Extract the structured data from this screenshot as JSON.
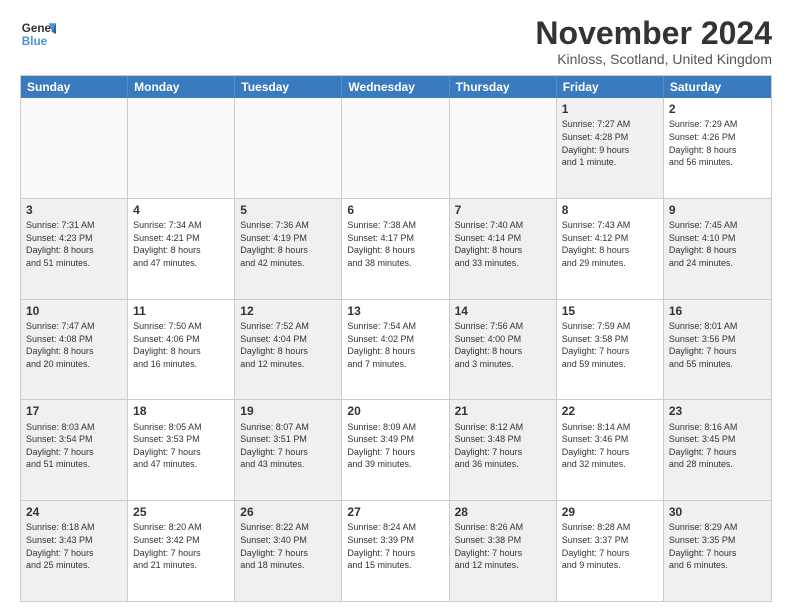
{
  "logo": {
    "line1": "General",
    "line2": "Blue"
  },
  "title": "November 2024",
  "subtitle": "Kinloss, Scotland, United Kingdom",
  "header_days": [
    "Sunday",
    "Monday",
    "Tuesday",
    "Wednesday",
    "Thursday",
    "Friday",
    "Saturday"
  ],
  "weeks": [
    [
      {
        "day": "",
        "text": "",
        "empty": true
      },
      {
        "day": "",
        "text": "",
        "empty": true
      },
      {
        "day": "",
        "text": "",
        "empty": true
      },
      {
        "day": "",
        "text": "",
        "empty": true
      },
      {
        "day": "",
        "text": "",
        "empty": true
      },
      {
        "day": "1",
        "text": "Sunrise: 7:27 AM\nSunset: 4:28 PM\nDaylight: 9 hours\nand 1 minute.",
        "shaded": true
      },
      {
        "day": "2",
        "text": "Sunrise: 7:29 AM\nSunset: 4:26 PM\nDaylight: 8 hours\nand 56 minutes.",
        "shaded": false
      }
    ],
    [
      {
        "day": "3",
        "text": "Sunrise: 7:31 AM\nSunset: 4:23 PM\nDaylight: 8 hours\nand 51 minutes.",
        "shaded": true
      },
      {
        "day": "4",
        "text": "Sunrise: 7:34 AM\nSunset: 4:21 PM\nDaylight: 8 hours\nand 47 minutes.",
        "shaded": false
      },
      {
        "day": "5",
        "text": "Sunrise: 7:36 AM\nSunset: 4:19 PM\nDaylight: 8 hours\nand 42 minutes.",
        "shaded": true
      },
      {
        "day": "6",
        "text": "Sunrise: 7:38 AM\nSunset: 4:17 PM\nDaylight: 8 hours\nand 38 minutes.",
        "shaded": false
      },
      {
        "day": "7",
        "text": "Sunrise: 7:40 AM\nSunset: 4:14 PM\nDaylight: 8 hours\nand 33 minutes.",
        "shaded": true
      },
      {
        "day": "8",
        "text": "Sunrise: 7:43 AM\nSunset: 4:12 PM\nDaylight: 8 hours\nand 29 minutes.",
        "shaded": false
      },
      {
        "day": "9",
        "text": "Sunrise: 7:45 AM\nSunset: 4:10 PM\nDaylight: 8 hours\nand 24 minutes.",
        "shaded": true
      }
    ],
    [
      {
        "day": "10",
        "text": "Sunrise: 7:47 AM\nSunset: 4:08 PM\nDaylight: 8 hours\nand 20 minutes.",
        "shaded": true
      },
      {
        "day": "11",
        "text": "Sunrise: 7:50 AM\nSunset: 4:06 PM\nDaylight: 8 hours\nand 16 minutes.",
        "shaded": false
      },
      {
        "day": "12",
        "text": "Sunrise: 7:52 AM\nSunset: 4:04 PM\nDaylight: 8 hours\nand 12 minutes.",
        "shaded": true
      },
      {
        "day": "13",
        "text": "Sunrise: 7:54 AM\nSunset: 4:02 PM\nDaylight: 8 hours\nand 7 minutes.",
        "shaded": false
      },
      {
        "day": "14",
        "text": "Sunrise: 7:56 AM\nSunset: 4:00 PM\nDaylight: 8 hours\nand 3 minutes.",
        "shaded": true
      },
      {
        "day": "15",
        "text": "Sunrise: 7:59 AM\nSunset: 3:58 PM\nDaylight: 7 hours\nand 59 minutes.",
        "shaded": false
      },
      {
        "day": "16",
        "text": "Sunrise: 8:01 AM\nSunset: 3:56 PM\nDaylight: 7 hours\nand 55 minutes.",
        "shaded": true
      }
    ],
    [
      {
        "day": "17",
        "text": "Sunrise: 8:03 AM\nSunset: 3:54 PM\nDaylight: 7 hours\nand 51 minutes.",
        "shaded": true
      },
      {
        "day": "18",
        "text": "Sunrise: 8:05 AM\nSunset: 3:53 PM\nDaylight: 7 hours\nand 47 minutes.",
        "shaded": false
      },
      {
        "day": "19",
        "text": "Sunrise: 8:07 AM\nSunset: 3:51 PM\nDaylight: 7 hours\nand 43 minutes.",
        "shaded": true
      },
      {
        "day": "20",
        "text": "Sunrise: 8:09 AM\nSunset: 3:49 PM\nDaylight: 7 hours\nand 39 minutes.",
        "shaded": false
      },
      {
        "day": "21",
        "text": "Sunrise: 8:12 AM\nSunset: 3:48 PM\nDaylight: 7 hours\nand 36 minutes.",
        "shaded": true
      },
      {
        "day": "22",
        "text": "Sunrise: 8:14 AM\nSunset: 3:46 PM\nDaylight: 7 hours\nand 32 minutes.",
        "shaded": false
      },
      {
        "day": "23",
        "text": "Sunrise: 8:16 AM\nSunset: 3:45 PM\nDaylight: 7 hours\nand 28 minutes.",
        "shaded": true
      }
    ],
    [
      {
        "day": "24",
        "text": "Sunrise: 8:18 AM\nSunset: 3:43 PM\nDaylight: 7 hours\nand 25 minutes.",
        "shaded": true
      },
      {
        "day": "25",
        "text": "Sunrise: 8:20 AM\nSunset: 3:42 PM\nDaylight: 7 hours\nand 21 minutes.",
        "shaded": false
      },
      {
        "day": "26",
        "text": "Sunrise: 8:22 AM\nSunset: 3:40 PM\nDaylight: 7 hours\nand 18 minutes.",
        "shaded": true
      },
      {
        "day": "27",
        "text": "Sunrise: 8:24 AM\nSunset: 3:39 PM\nDaylight: 7 hours\nand 15 minutes.",
        "shaded": false
      },
      {
        "day": "28",
        "text": "Sunrise: 8:26 AM\nSunset: 3:38 PM\nDaylight: 7 hours\nand 12 minutes.",
        "shaded": true
      },
      {
        "day": "29",
        "text": "Sunrise: 8:28 AM\nSunset: 3:37 PM\nDaylight: 7 hours\nand 9 minutes.",
        "shaded": false
      },
      {
        "day": "30",
        "text": "Sunrise: 8:29 AM\nSunset: 3:35 PM\nDaylight: 7 hours\nand 6 minutes.",
        "shaded": true
      }
    ]
  ]
}
